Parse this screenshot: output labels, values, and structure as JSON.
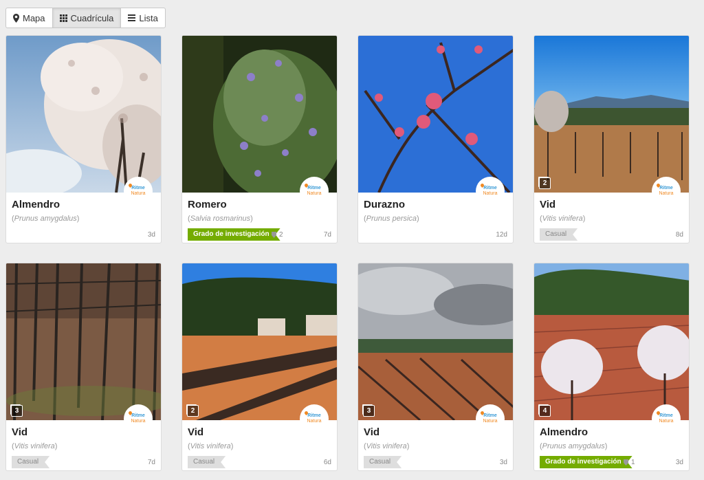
{
  "view_toggle": {
    "map_label": "Mapa",
    "grid_label": "Cuadrícula",
    "list_label": "Lista",
    "active": "grid"
  },
  "logo": {
    "line1": "Ritme",
    "line2": "Natura"
  },
  "colors": {
    "research_grade": "#74ac00",
    "casual_grade": "#dedede",
    "logo_blue": "#3a9bd6",
    "logo_orange": "#f08a24"
  },
  "observations": [
    {
      "common_name": "Almendro",
      "scientific_name": "Prunus amygdalus",
      "age": "3d",
      "grade": "",
      "identifications": "",
      "photo_count": ""
    },
    {
      "common_name": "Romero",
      "scientific_name": "Salvia rosmarinus",
      "age": "7d",
      "grade": "Grado de investigación",
      "identifications": "2",
      "photo_count": ""
    },
    {
      "common_name": "Durazno",
      "scientific_name": "Prunus persica",
      "age": "12d",
      "grade": "",
      "identifications": "",
      "photo_count": ""
    },
    {
      "common_name": "Vid",
      "scientific_name": "Vitis vinifera",
      "age": "8d",
      "grade": "Casual",
      "identifications": "",
      "photo_count": "2"
    },
    {
      "common_name": "Vid",
      "scientific_name": "Vitis vinifera",
      "age": "7d",
      "grade": "Casual",
      "identifications": "",
      "photo_count": "3"
    },
    {
      "common_name": "Vid",
      "scientific_name": "Vitis vinifera",
      "age": "6d",
      "grade": "Casual",
      "identifications": "",
      "photo_count": "2"
    },
    {
      "common_name": "Vid",
      "scientific_name": "Vitis vinifera",
      "age": "3d",
      "grade": "Casual",
      "identifications": "",
      "photo_count": "3"
    },
    {
      "common_name": "Almendro",
      "scientific_name": "Prunus amygdalus",
      "age": "3d",
      "grade": "Grado de investigación",
      "identifications": "1",
      "photo_count": "4"
    }
  ]
}
